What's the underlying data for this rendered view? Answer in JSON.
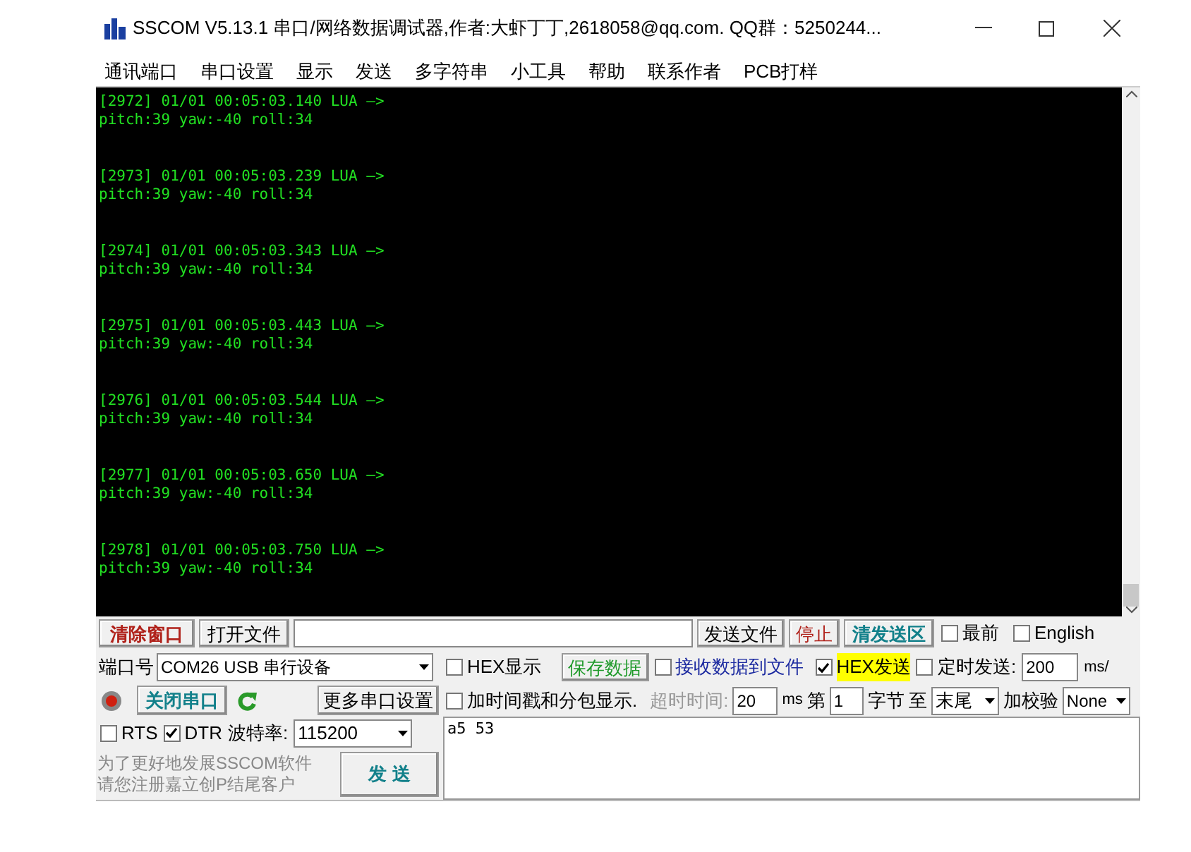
{
  "window": {
    "title": "SSCOM V5.13.1 串口/网络数据调试器,作者:大虾丁丁,2618058@qq.com. QQ群：5250244..."
  },
  "menu": [
    "通讯端口",
    "串口设置",
    "显示",
    "发送",
    "多字符串",
    "小工具",
    "帮助",
    "联系作者",
    "PCB打样"
  ],
  "terminal": {
    "records": [
      {
        "header": "[2972] 01/01 00:05:03.140 LUA —>",
        "body": "pitch:39 yaw:-40 roll:34"
      },
      {
        "header": "[2973] 01/01 00:05:03.239 LUA —>",
        "body": "pitch:39 yaw:-40 roll:34"
      },
      {
        "header": "[2974] 01/01 00:05:03.343 LUA —>",
        "body": "pitch:39 yaw:-40 roll:34"
      },
      {
        "header": "[2975] 01/01 00:05:03.443 LUA —>",
        "body": "pitch:39 yaw:-40 roll:34"
      },
      {
        "header": "[2976] 01/01 00:05:03.544 LUA —>",
        "body": "pitch:39 yaw:-40 roll:34"
      },
      {
        "header": "[2977] 01/01 00:05:03.650 LUA —>",
        "body": "pitch:39 yaw:-40 roll:34"
      },
      {
        "header": "[2978] 01/01 00:05:03.750 LUA —>",
        "body": "pitch:39 yaw:-40 roll:34"
      }
    ]
  },
  "toolbar": {
    "clear_button": "清除窗口",
    "open_file_button": "打开文件",
    "send_file_button": "发送文件",
    "stop_button": "停止",
    "clear_send_button": "清发送区",
    "checks": [
      {
        "label": "最前",
        "checked": false
      },
      {
        "label": "English",
        "checked": false
      }
    ]
  },
  "port": {
    "label": "端口号",
    "value": "COM26 USB 串行设备",
    "close_button": "关闭串口",
    "open": true,
    "more_button": "更多串口设置",
    "rts": {
      "label": "RTS",
      "checked": false
    },
    "dtr": {
      "label": "DTR",
      "checked": true
    },
    "baud_label": "波特率:",
    "baud": "115200",
    "promo": [
      "为了更好地发展SSCOM软件",
      "请您注册嘉立创P结尾客户"
    ],
    "send_button": "发 送"
  },
  "options": {
    "hex_display": {
      "label": "HEX显示",
      "checked": false
    },
    "save_button": "保存数据",
    "recv_to_file": {
      "label": "接收数据到文件",
      "checked": false
    },
    "hex_send": {
      "label": "HEX发送",
      "checked": true
    },
    "timed_send": {
      "label": "定时发送:",
      "checked": false
    },
    "interval": "200",
    "interval_unit": "ms/",
    "timestamp": {
      "label": "加时间戳和分包显示.",
      "checked": false
    },
    "timeout_label": "超时时间:",
    "timeout": "20",
    "timeout_unit": "ms",
    "from_label": "第",
    "from": "1",
    "byte_label": "字节",
    "to_label": "至",
    "to": "末尾",
    "checksum_label": "加校验",
    "checksum": "None"
  },
  "send_text": "a5 53"
}
